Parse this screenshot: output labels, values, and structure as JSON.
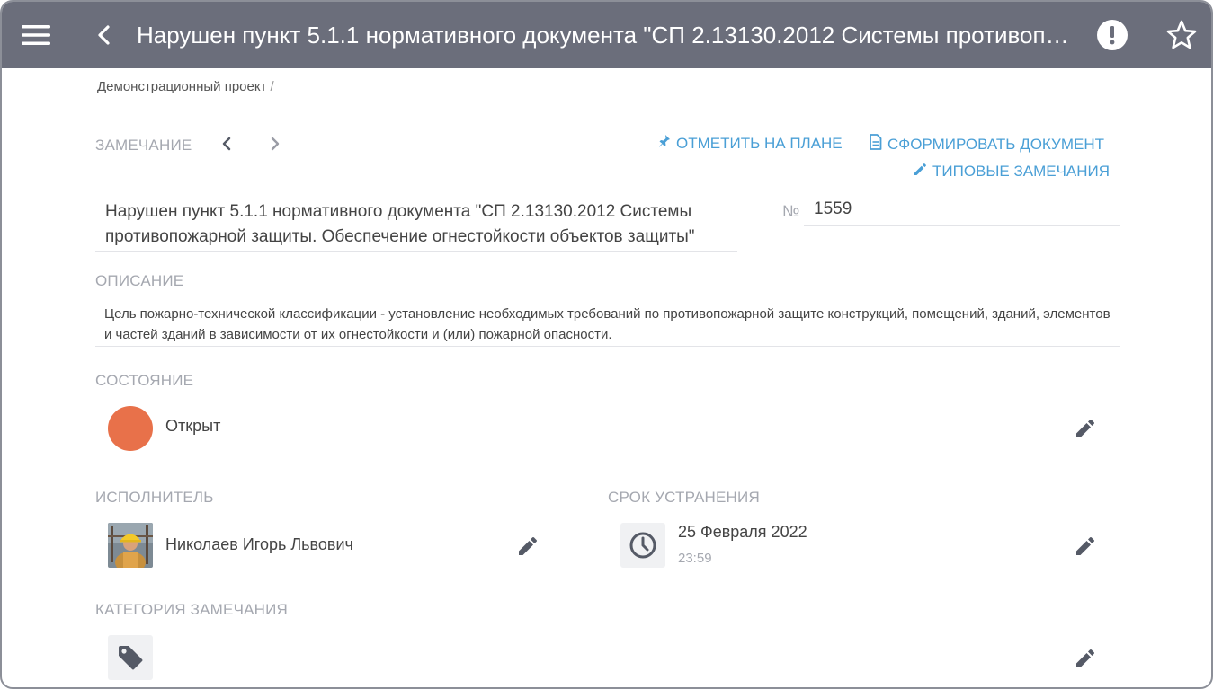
{
  "header": {
    "title": "Нарушен пункт 5.1.1 нормативного документа \"СП 2.13130.2012 Системы противопожарной защиты. Обеспечение огнестойкости объектов защиты\"",
    "bg_color": "#6b6e7b",
    "icons": [
      "menu-icon",
      "back-icon",
      "alert-icon",
      "star-icon"
    ]
  },
  "breadcrumb": {
    "project": "Демонстрационный проект",
    "separator": "/"
  },
  "remark_section": {
    "label": "ЗАМЕЧАНИЕ",
    "actions": {
      "mark_on_plan": "ОТМЕТИТЬ НА ПЛАНЕ",
      "generate_document": "СФОРМИРОВАТЬ ДОКУМЕНТ",
      "typical_remarks": "ТИПОВЫЕ ЗАМЕЧАНИЯ"
    },
    "accent_color": "#4a9fd6"
  },
  "remark": {
    "title": "Нарушен пункт 5.1.1 нормативного документа \"СП 2.13130.2012 Системы противопожарной защиты. Обеспечение огнестойкости объектов защиты\"",
    "number_label": "№",
    "number": "1559"
  },
  "description": {
    "label": "ОПИСАНИЕ",
    "text": "Цель пожарно-технической классификации - установление необходимых требований по противопожарной защите конструкций, помещений, зданий, элементов и частей зданий в зависимости от их огнестойкости и (или) пожарной опасности."
  },
  "status": {
    "label": "СОСТОЯНИЕ",
    "value": "Открыт",
    "color": "#e8714a"
  },
  "assignee": {
    "label": "ИСПОЛНИТЕЛЬ",
    "name": "Николаев Игорь Львович"
  },
  "deadline": {
    "label": "СРОК УСТРАНЕНИЯ",
    "date": "25 Февраля 2022",
    "time": "23:59"
  },
  "category": {
    "label": "КАТЕГОРИЯ ЗАМЕЧАНИЯ"
  }
}
